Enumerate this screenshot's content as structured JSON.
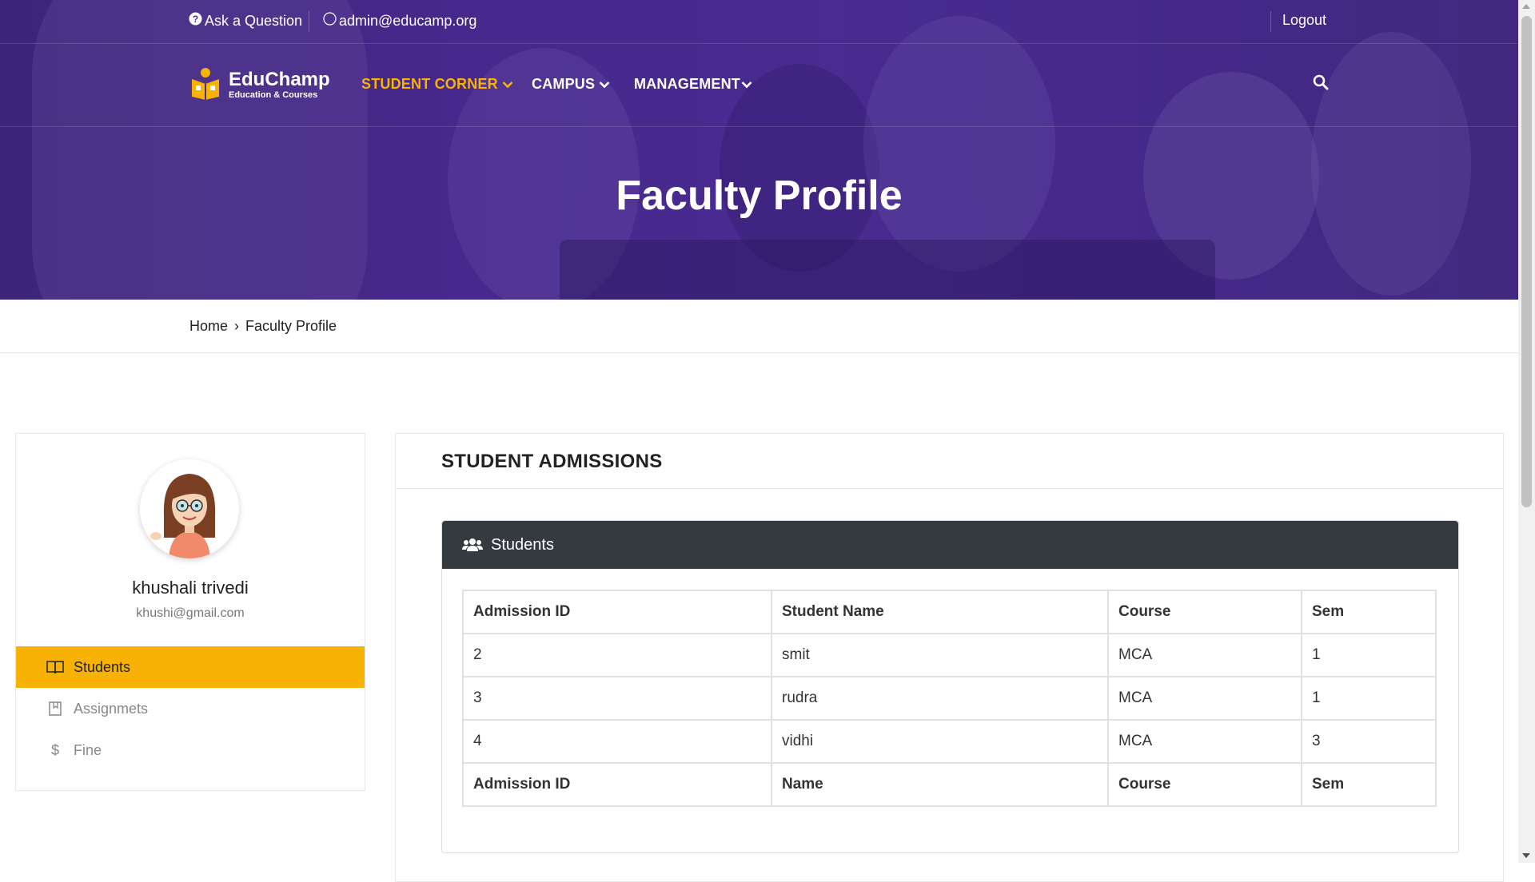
{
  "topbar": {
    "ask_label": "Ask a Question",
    "email": "admin@educamp.org",
    "logout_label": "Logout"
  },
  "logo": {
    "name": "EduChamp",
    "tagline": "Education & Courses"
  },
  "nav": {
    "items": [
      {
        "label": "STUDENT CORNER",
        "active": true
      },
      {
        "label": "CAMPUS",
        "active": false
      },
      {
        "label": "MANAGEMENT",
        "active": false
      }
    ]
  },
  "hero": {
    "title": "Faculty Profile"
  },
  "breadcrumb": {
    "home": "Home",
    "separator": "›",
    "current": "Faculty Profile"
  },
  "profile": {
    "name": "khushali trivedi",
    "email": "khushi@gmail.com",
    "menu": [
      {
        "label": "Students",
        "icon": "book-open-icon",
        "active": true
      },
      {
        "label": "Assignmets",
        "icon": "bookmark-book-icon",
        "active": false
      },
      {
        "label": "Fine",
        "icon": "dollar-icon",
        "active": false
      }
    ]
  },
  "admissions": {
    "title": "STUDENT ADMISSIONS",
    "card_title": "Students",
    "header": [
      "Admission ID",
      "Student Name",
      "Course",
      "Sem"
    ],
    "rows": [
      [
        "2",
        "smit",
        "MCA",
        "1"
      ],
      [
        "3",
        "rudra",
        "MCA",
        "1"
      ],
      [
        "4",
        "vidhi",
        "MCA",
        "3"
      ]
    ],
    "footer": [
      "Admission ID",
      "Name",
      "Course",
      "Sem"
    ]
  },
  "colors": {
    "accent": "#f7b205",
    "hero_purple": "#4d2e92",
    "card_header": "#343a40"
  }
}
